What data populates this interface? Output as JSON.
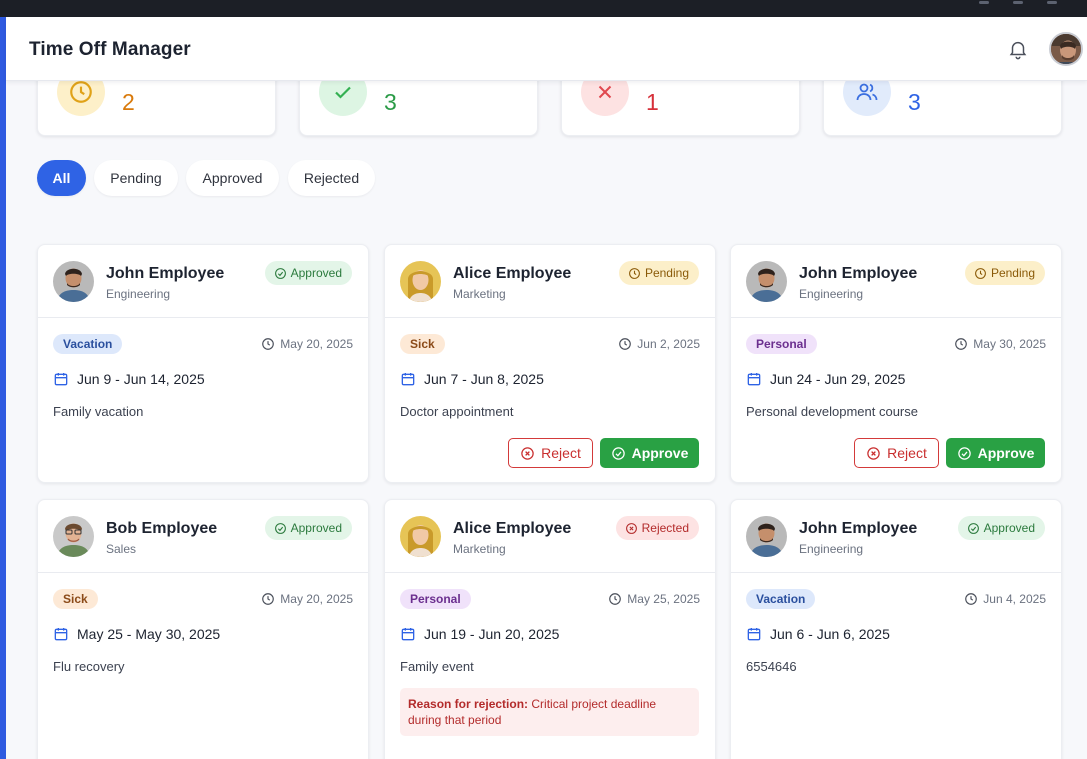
{
  "app": {
    "title": "Time Off Manager"
  },
  "header": {
    "notifications_icon": "bell-icon",
    "avatar_icon": "user-avatar"
  },
  "stats": [
    {
      "icon": "clock-icon",
      "value": "2",
      "color": "#d97a0b",
      "bg": "#fdf0c9"
    },
    {
      "icon": "check-icon",
      "value": "3",
      "color": "#2b9b47",
      "bg": "#ddf5e3"
    },
    {
      "icon": "x-icon",
      "value": "1",
      "color": "#d6303a",
      "bg": "#fde2e2"
    },
    {
      "icon": "users-icon",
      "value": "3",
      "color": "#2f63e5",
      "bg": "#e1ebfb"
    }
  ],
  "filters": {
    "all": "All",
    "pending": "Pending",
    "approved": "Approved",
    "rejected": "Rejected",
    "active": "All"
  },
  "requests": [
    {
      "name": "John Employee",
      "dept": "Engineering",
      "status": "Approved",
      "type": "Vacation",
      "submitted": "May 20, 2025",
      "dates": "Jun 9 - Jun 14, 2025",
      "reason": "Family vacation"
    },
    {
      "name": "Alice Employee",
      "dept": "Marketing",
      "status": "Pending",
      "type": "Sick",
      "submitted": "Jun 2, 2025",
      "dates": "Jun 7 - Jun 8, 2025",
      "reason": "Doctor appointment",
      "reject_label": "Reject",
      "approve_label": "Approve"
    },
    {
      "name": "John Employee",
      "dept": "Engineering",
      "status": "Pending",
      "type": "Personal",
      "submitted": "May 30, 2025",
      "dates": "Jun 24 - Jun 29, 2025",
      "reason": "Personal development course",
      "reject_label": "Reject",
      "approve_label": "Approve"
    },
    {
      "name": "Bob Employee",
      "dept": "Sales",
      "status": "Approved",
      "type": "Sick",
      "submitted": "May 20, 2025",
      "dates": "May 25 - May 30, 2025",
      "reason": "Flu recovery"
    },
    {
      "name": "Alice Employee",
      "dept": "Marketing",
      "status": "Rejected",
      "type": "Personal",
      "submitted": "May 25, 2025",
      "dates": "Jun 19 - Jun 20, 2025",
      "reason": "Family event",
      "rejection_label": "Reason for rejection:",
      "rejection_text": "Critical project deadline during that period"
    },
    {
      "name": "John Employee",
      "dept": "Engineering",
      "status": "Approved",
      "type": "Vacation",
      "submitted": "Jun 4, 2025",
      "dates": "Jun 6 - Jun 6, 2025",
      "reason": "6554646"
    }
  ]
}
